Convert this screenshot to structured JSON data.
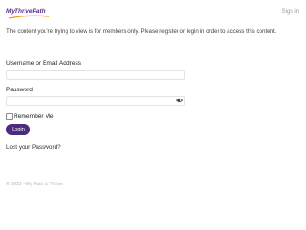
{
  "header": {
    "logo_text": "MyThrivePath",
    "signin_label": "Sign in",
    "colors": {
      "brand": "#5c2b91",
      "swoosh": "#e8a228"
    }
  },
  "main": {
    "notice": "The content you're trying to view is for members only. Please register or login in order to access this content.",
    "username_label": "Username or Email Address",
    "username_value": "",
    "password_label": "Password",
    "password_value": "",
    "password_toggle_icon": "eye-icon",
    "remember_label": "Remember Me",
    "remember_checked": false,
    "login_label": "Login",
    "lost_password_label": "Lost your Password?",
    "colors": {
      "button": "#4b2a80"
    }
  },
  "footer": {
    "copyright": "© 2022 - My Path to Thrive"
  }
}
